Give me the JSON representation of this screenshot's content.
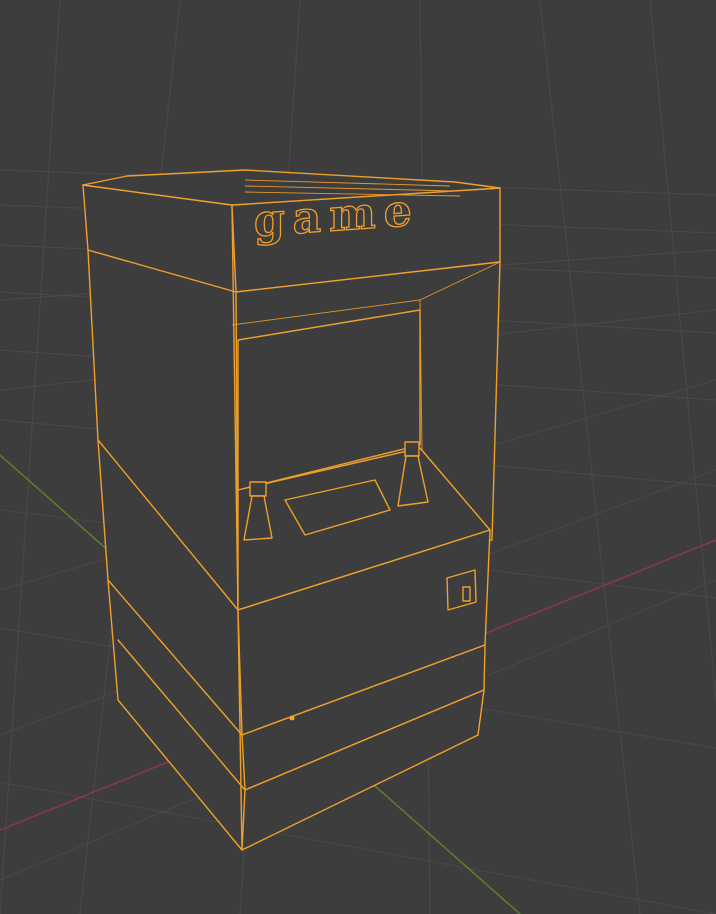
{
  "viewport": {
    "background": "#3d3d3d",
    "grid_color": "#4a4a4a",
    "x_axis_color": "#8a3a44",
    "y_axis_color": "#5e7f2d",
    "selection_color": "#f0a02a"
  },
  "object": {
    "name_icon": "arcade-cabinet-wireframe",
    "selected": true,
    "marquee_text": "game"
  }
}
